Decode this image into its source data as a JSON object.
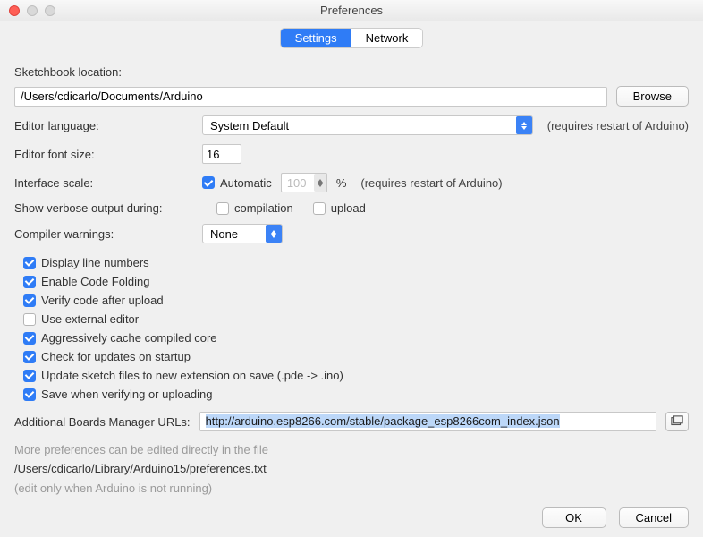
{
  "window": {
    "title": "Preferences"
  },
  "tabs": {
    "settings": "Settings",
    "network": "Network"
  },
  "sketchbook": {
    "label": "Sketchbook location:",
    "path": "/Users/cdicarlo/Documents/Arduino",
    "browse": "Browse"
  },
  "editor_language": {
    "label": "Editor language:",
    "value": "System Default",
    "hint": "(requires restart of Arduino)"
  },
  "editor_font": {
    "label": "Editor font size:",
    "value": "16"
  },
  "interface_scale": {
    "label": "Interface scale:",
    "automatic_label": "Automatic",
    "value": "100",
    "percent": "%",
    "hint": "(requires restart of Arduino)"
  },
  "verbose": {
    "label": "Show verbose output during:",
    "compilation": "compilation",
    "upload": "upload"
  },
  "compiler_warnings": {
    "label": "Compiler warnings:",
    "value": "None"
  },
  "checks": {
    "display_line_numbers": "Display line numbers",
    "enable_code_folding": "Enable Code Folding",
    "verify_code_after_upload": "Verify code after upload",
    "use_external_editor": "Use external editor",
    "aggressively_cache": "Aggressively cache compiled core",
    "check_updates": "Check for updates on startup",
    "update_sketch_ext": "Update sketch files to new extension on save (.pde -> .ino)",
    "save_when_verifying": "Save when verifying or uploading"
  },
  "boards": {
    "label": "Additional Boards Manager URLs:",
    "url": "http://arduino.esp8266.com/stable/package_esp8266com_index.json"
  },
  "more_prefs": {
    "line1": "More preferences can be edited directly in the file",
    "path": "/Users/cdicarlo/Library/Arduino15/preferences.txt",
    "line3": "(edit only when Arduino is not running)"
  },
  "buttons": {
    "ok": "OK",
    "cancel": "Cancel"
  }
}
